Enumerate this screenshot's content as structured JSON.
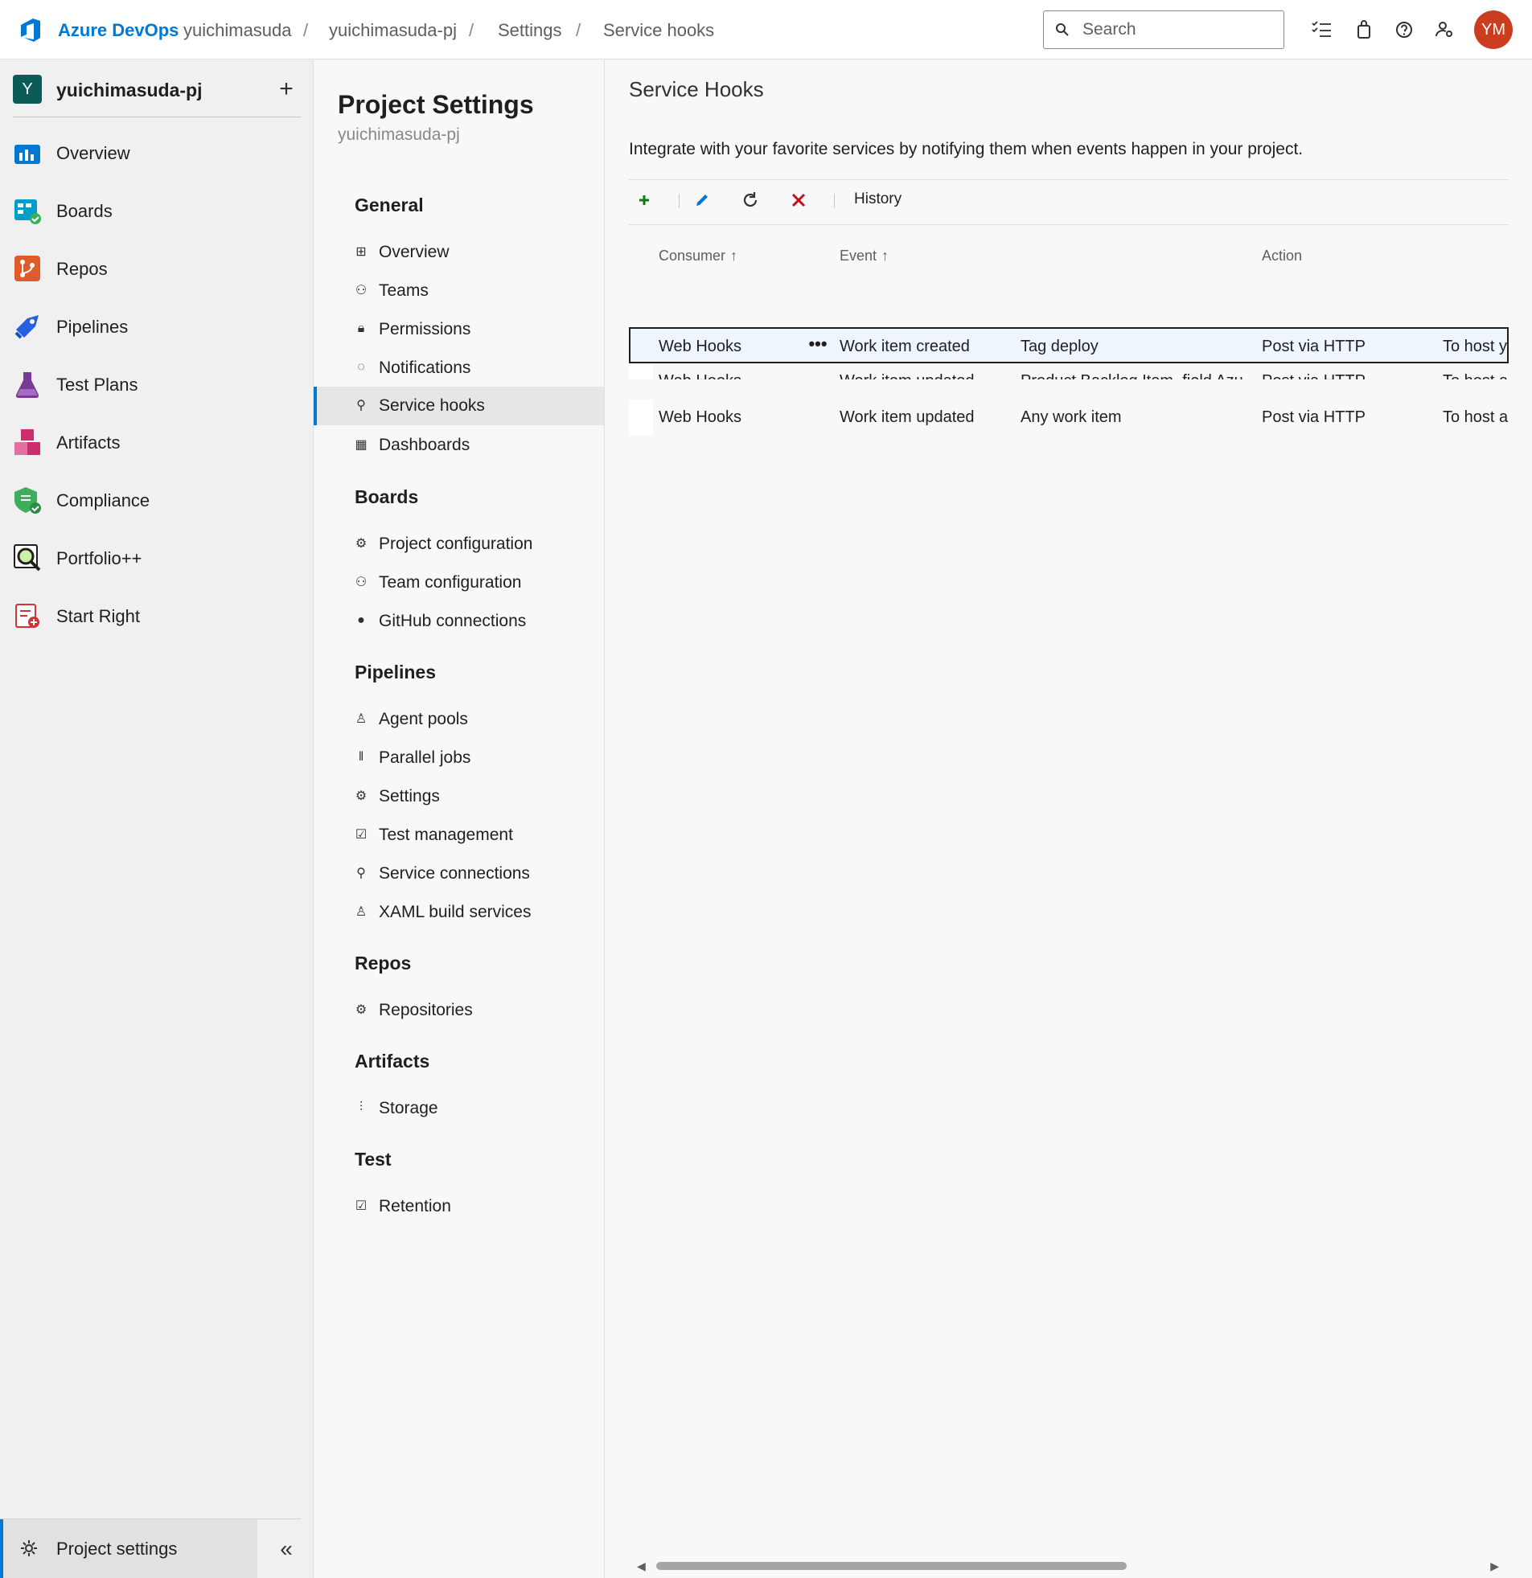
{
  "topbar": {
    "brand": "Azure DevOps",
    "breadcrumbs": [
      "yuichimasuda",
      "yuichimasuda-pj",
      "Settings",
      "Service hooks"
    ],
    "search_placeholder": "Search",
    "avatar_initials": "YM",
    "icons": [
      "task-list-icon",
      "shopping-bag-icon",
      "help-icon",
      "user-settings-icon"
    ]
  },
  "leftnav": {
    "project_badge": "Y",
    "project_name": "yuichimasuda-pj",
    "add_label": "+",
    "items": [
      {
        "label": "Overview",
        "icon": "overview-icon",
        "color": "#0078d4"
      },
      {
        "label": "Boards",
        "icon": "boards-icon",
        "color": "#009ccc"
      },
      {
        "label": "Repos",
        "icon": "repos-icon",
        "color": "#e05b2a"
      },
      {
        "label": "Pipelines",
        "icon": "pipelines-icon",
        "color": "#2560e0"
      },
      {
        "label": "Test Plans",
        "icon": "test-plans-icon",
        "color": "#773b93"
      },
      {
        "label": "Artifacts",
        "icon": "artifacts-icon",
        "color": "#cb2e6d"
      },
      {
        "label": "Compliance",
        "icon": "compliance-icon",
        "color": "#3fae5b"
      },
      {
        "label": "Portfolio++",
        "icon": "portfolio-icon",
        "color": "#201f1e"
      },
      {
        "label": "Start Right",
        "icon": "start-right-icon",
        "color": "#d13438"
      }
    ],
    "project_settings_label": "Project settings",
    "collapse_label": "«"
  },
  "settings": {
    "title": "Project Settings",
    "subtitle": "yuichimasuda-pj",
    "sections": [
      {
        "heading": "General",
        "items": [
          "Overview",
          "Teams",
          "Permissions",
          "Notifications",
          "Service hooks",
          "Dashboards"
        ]
      },
      {
        "heading": "Boards",
        "items": [
          "Project configuration",
          "Team configuration",
          "GitHub connections"
        ]
      },
      {
        "heading": "Pipelines",
        "items": [
          "Agent pools",
          "Parallel jobs",
          "Settings",
          "Test management",
          "Service connections",
          "XAML build services"
        ]
      },
      {
        "heading": "Repos",
        "items": [
          "Repositories"
        ]
      },
      {
        "heading": "Artifacts",
        "items": [
          "Storage"
        ]
      },
      {
        "heading": "Test",
        "items": [
          "Retention"
        ]
      }
    ],
    "active_item": "Service hooks"
  },
  "main": {
    "title": "Service Hooks",
    "description": "Integrate with your favorite services by notifying them when events happen in your project.",
    "toolbar": {
      "history_label": "History",
      "icons": [
        "add-icon",
        "edit-icon",
        "refresh-icon",
        "delete-icon"
      ]
    },
    "columns": {
      "consumer": "Consumer",
      "event": "Event",
      "action": "Action",
      "sort_arrow": "↑"
    },
    "rows": [
      {
        "consumer": "Web Hooks",
        "event": "Work item created",
        "filter": "Tag deploy",
        "action": "Post via HTTP",
        "target": "To host yo"
      },
      {
        "consumer": "Web Hooks",
        "event": "Work item updated",
        "filter": "Product Backlog Item, field Azu...",
        "action": "Post via HTTP",
        "target": "To host ap"
      },
      {
        "consumer": "Web Hooks",
        "event": "Work item updated",
        "filter": "Any work item",
        "action": "Post via HTTP",
        "target": "To host ap"
      }
    ],
    "more_label": "•••"
  }
}
